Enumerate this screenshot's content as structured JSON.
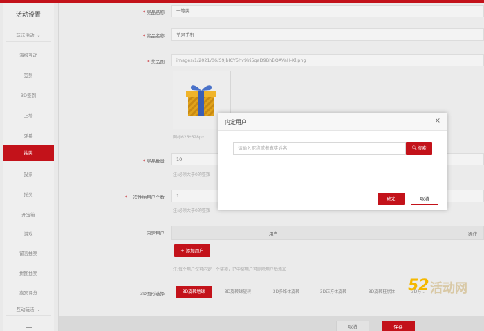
{
  "sidebar": {
    "title": "活动设置",
    "group_top": "玩法活动",
    "items": [
      {
        "label": "海报互动"
      },
      {
        "label": "签到"
      },
      {
        "label": "3D签到"
      },
      {
        "label": "上墙"
      },
      {
        "label": "弹幕"
      },
      {
        "label": "抽奖"
      },
      {
        "label": "投票"
      },
      {
        "label": "摇奖"
      },
      {
        "label": "开宝箱"
      },
      {
        "label": "游戏"
      },
      {
        "label": "留言抽奖"
      },
      {
        "label": "拼图抽奖"
      },
      {
        "label": "嘉宾评分"
      }
    ],
    "group_bottom": "互动玩法"
  },
  "form": {
    "prize_name_label": "奖品名称",
    "prize_name_value": "一等奖",
    "prize_title_label": "奖品名称",
    "prize_title_value": "苹果手机",
    "prize_image_label": "奖品图",
    "prize_image_path": "images/1/2021/06/S9jbICY5hv9lri5qaD9BhBQAVaH-Kl.png",
    "image_size_hint": "图标626*628px",
    "quantity_label": "奖品数量",
    "quantity_value": "10",
    "quantity_hint": "注:必须大于0的整数",
    "per_user_label": "一次性抽用户个数",
    "per_user_value": "1",
    "per_user_hint": "注:必须大于0的整数",
    "assigned_label": "内定用户",
    "table_col_user": "用户",
    "table_col_action": "操作",
    "add_user_button": "+ 添加用户",
    "assigned_note": "注:每个用户仅可内定一个奖项，已中奖用户可删除用户后添加",
    "style_label": "3D图形选择",
    "style_tabs": [
      "3D旋转地球",
      "3D旋转球旋转",
      "3D多维体旋转",
      "3D正方体旋转",
      "3D旋转柱状体",
      "3D方..."
    ],
    "cancel_button": "取消",
    "save_button": "保存"
  },
  "modal": {
    "title": "内定用户",
    "close_glyph": "×",
    "search_placeholder": "请输入昵称或者真实姓名",
    "search_button": "搜索",
    "ok_button": "确定",
    "cancel_button": "取消"
  },
  "watermark": {
    "number": "52",
    "text": "活动网"
  },
  "colors": {
    "accent": "#c3121a",
    "watermark_number": "#f5b800"
  }
}
